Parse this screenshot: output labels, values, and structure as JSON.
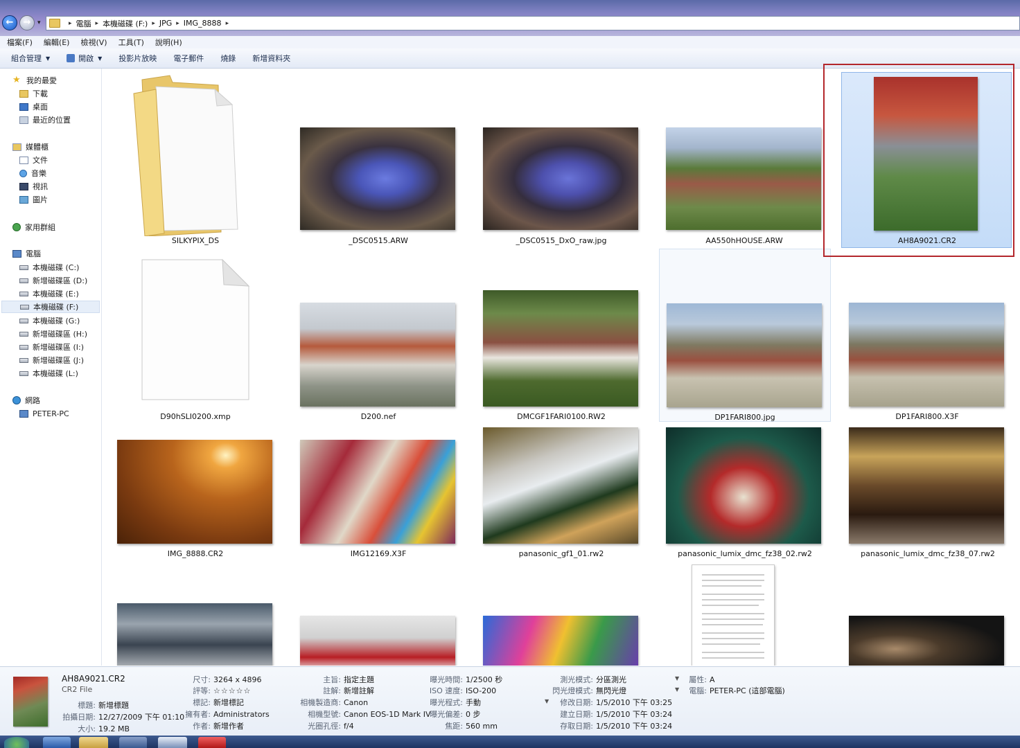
{
  "address": {
    "crumbs": [
      "電腦",
      "本機磁碟 (F:)",
      "JPG",
      "IMG_8888"
    ]
  },
  "menu": [
    "檔案(F)",
    "編輯(E)",
    "檢視(V)",
    "工具(T)",
    "說明(H)"
  ],
  "toolbar": {
    "organize": "組合管理",
    "open": "開啟",
    "slideshow": "投影片放映",
    "email": "電子郵件",
    "burn": "燒錄",
    "new_folder": "新增資料夾"
  },
  "sidebar": {
    "favorites": "我的最愛",
    "downloads": "下載",
    "desktop": "桌面",
    "recent": "最近的位置",
    "libraries": "媒體櫃",
    "documents": "文件",
    "music": "音樂",
    "videos": "視訊",
    "pictures": "圖片",
    "homegroup": "家用群組",
    "computer": "電腦",
    "drives": [
      "本機磁碟 (C:)",
      "新增磁碟區 (D:)",
      "本機磁碟 (E:)",
      "本機磁碟 (F:)",
      "本機磁碟 (G:)",
      "新增磁碟區 (H:)",
      "新增磁碟區 (I:)",
      "新增磁碟區 (J:)",
      "本機磁碟 (L:)"
    ],
    "network": "網路",
    "peter_pc": "PETER-PC"
  },
  "files": [
    "SILKYPIX_DS",
    "_DSC0515.ARW",
    "_DSC0515_DxO_raw.jpg",
    "AA550hHOUSE.ARW",
    "AH8A9021.CR2",
    "D90hSLI0200.xmp",
    "D200.nef",
    "DMCGF1FARI0100.RW2",
    "DP1FARI800.jpg",
    "DP1FARI800.X3F",
    "IMG_8888.CR2",
    "IMG12169.X3F",
    "panasonic_gf1_01.rw2",
    "panasonic_lumix_dmc_fz38_02.rw2",
    "panasonic_lumix_dmc_fz38_07.rw2"
  ],
  "details": {
    "name": "AH8A9021.CR2",
    "type": "CR2 File",
    "col1": [
      {
        "k": "標題:",
        "v": "新增標題"
      },
      {
        "k": "拍攝日期:",
        "v": "12/27/2009 下午 01:10"
      },
      {
        "k": "大小:",
        "v": "19.2 MB"
      }
    ],
    "col2": [
      {
        "k": "尺寸:",
        "v": "3264 x 4896"
      },
      {
        "k": "評等:",
        "v": "☆☆☆☆☆"
      },
      {
        "k": "標記:",
        "v": "新增標記"
      },
      {
        "k": "擁有者:",
        "v": "Administrators"
      },
      {
        "k": "作者:",
        "v": "新增作者"
      }
    ],
    "col3": [
      {
        "k": "主旨:",
        "v": "指定主題"
      },
      {
        "k": "註解:",
        "v": "新增註解"
      },
      {
        "k": "相機製造商:",
        "v": "Canon"
      },
      {
        "k": "相機型號:",
        "v": "Canon EOS-1D Mark IV"
      },
      {
        "k": "光圈孔徑:",
        "v": "f/4"
      }
    ],
    "col4": [
      {
        "k": "曝光時間:",
        "v": "1/2500 秒"
      },
      {
        "k": "ISO 速度:",
        "v": "ISO-200"
      },
      {
        "k": "曝光程式:",
        "v": "手動"
      },
      {
        "k": "曝光偏差:",
        "v": "0 步"
      },
      {
        "k": "焦距:",
        "v": "560 mm"
      }
    ],
    "col5": [
      {
        "k": "測光模式:",
        "v": "分區測光"
      },
      {
        "k": "閃光燈模式:",
        "v": "無閃光燈"
      },
      {
        "k": "修改日期:",
        "v": "1/5/2010 下午 03:25"
      },
      {
        "k": "建立日期:",
        "v": "1/5/2010 下午 03:24"
      },
      {
        "k": "存取日期:",
        "v": "1/5/2010 下午 03:24"
      }
    ],
    "col6": [
      {
        "k": "屬性:",
        "v": "A"
      },
      {
        "k": "電腦:",
        "v": "PETER-PC (這部電腦)"
      }
    ]
  }
}
